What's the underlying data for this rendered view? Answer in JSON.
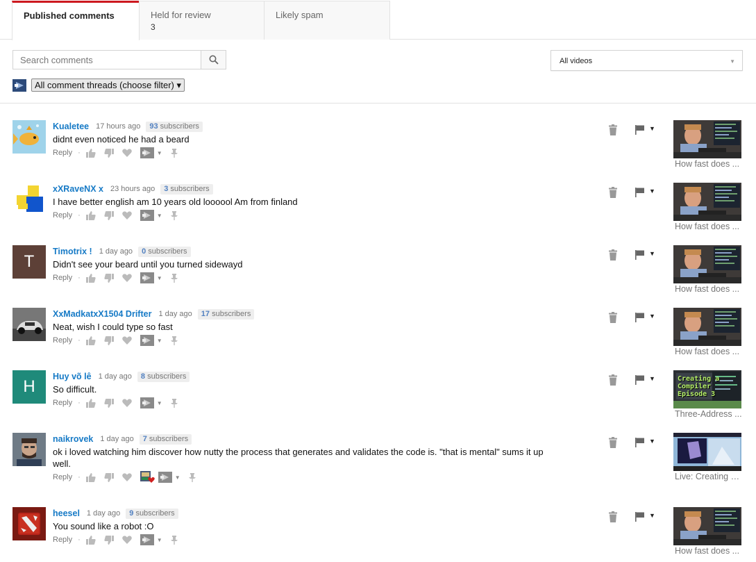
{
  "tabs": [
    {
      "label": "Published comments",
      "count": ""
    },
    {
      "label": "Held for review",
      "count": "3"
    },
    {
      "label": "Likely spam",
      "count": ""
    }
  ],
  "search": {
    "placeholder": "Search comments"
  },
  "video_filter": {
    "selected": "All videos"
  },
  "thread_filter": {
    "selected": "All comment threads (choose filter)"
  },
  "colors": {
    "accent": "#cc181e",
    "link": "#167ac6",
    "subs": "#5281c1"
  },
  "actions": {
    "reply_label": "Reply",
    "separator": "·"
  },
  "comments": [
    {
      "author": "Kualetee",
      "time": "17 hours ago",
      "subs_count": "93",
      "subs_label": "subscribers",
      "text": "didnt even noticed he had a beard",
      "video_title": "How fast does ...",
      "avatar": "fish-avatar"
    },
    {
      "author": "xXRaveNX x",
      "time": "23 hours ago",
      "subs_count": "3",
      "subs_label": "subscribers",
      "text": "I have better english am 10 years old loooool Am from finland",
      "video_title": "How fast does ...",
      "avatar": "block-figure-avatar"
    },
    {
      "author": "Timotrix !",
      "time": "1 day ago",
      "subs_count": "0",
      "subs_label": "subscribers",
      "text": "Didn't see your beard until you turned sidewayd",
      "video_title": "How fast does ...",
      "avatar_letter": "T",
      "avatar_color": "#5d4037"
    },
    {
      "author": "XxMadkatxX1504 Drifter",
      "time": "1 day ago",
      "subs_count": "17",
      "subs_label": "subscribers",
      "text": "Neat, wish I could type so fast",
      "video_title": "How fast does ...",
      "avatar": "car-avatar"
    },
    {
      "author": "Huy võ lê",
      "time": "1 day ago",
      "subs_count": "8",
      "subs_label": "subscribers",
      "text": "So difficult.",
      "video_title": "Three-Address ...",
      "avatar_letter": "H",
      "avatar_color": "#1f8a7a"
    },
    {
      "author": "naikrovek",
      "time": "1 day ago",
      "subs_count": "7",
      "subs_label": "subscribers",
      "text": "ok i loved watching him discover how nutty the process that generates and validates the code is.  \"that is mental\" sums it up well.",
      "video_title": "Live: Creating C...",
      "avatar": "man-avatar"
    },
    {
      "author": "heesel",
      "time": "1 day ago",
      "subs_count": "9",
      "subs_label": "subscribers",
      "text": "You sound like a robot :O",
      "video_title": "How fast does ...",
      "avatar": "dota-avatar"
    }
  ],
  "thumb_text": {
    "line1": "Creating a",
    "line2": "Compiler",
    "line3": "Episode 3"
  }
}
